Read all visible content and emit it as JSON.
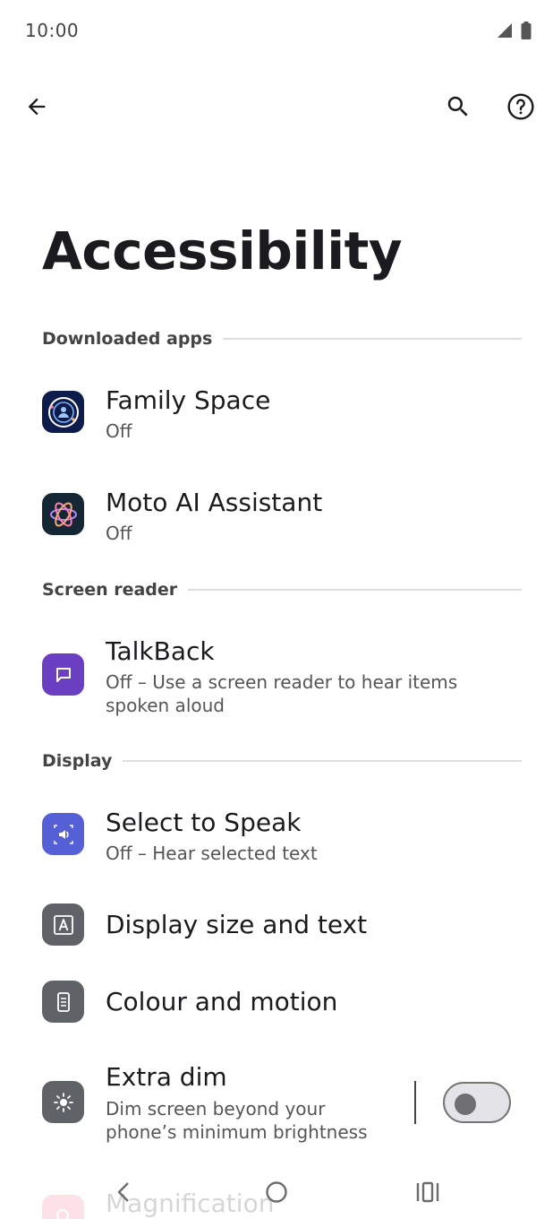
{
  "status_bar": {
    "time": "10:00"
  },
  "app_bar": {
    "back_icon": "arrow-back-icon",
    "search_icon": "search-icon",
    "help_icon": "help-circle-icon"
  },
  "page": {
    "title": "Accessibility"
  },
  "sections": {
    "downloaded_apps": "Downloaded apps",
    "screen_reader": "Screen reader",
    "display": "Display"
  },
  "items": {
    "family_space": {
      "title": "Family Space",
      "summary": "Off"
    },
    "moto_ai": {
      "title": "Moto AI Assistant",
      "summary": "Off"
    },
    "talkback": {
      "title": "TalkBack",
      "summary": "Off – Use a screen reader to hear items spoken aloud"
    },
    "select_to_speak": {
      "title": "Select to Speak",
      "summary": "Off – Hear selected text"
    },
    "display_size": {
      "title": "Display size and text"
    },
    "colour_motion": {
      "title": "Colour and motion"
    },
    "extra_dim": {
      "title": "Extra dim",
      "summary": "Dim screen beyond your phone’s minimum brightness",
      "toggle_on": false
    },
    "magnification": {
      "title": "Magnification"
    }
  },
  "colors": {
    "talkback_bg": "#6a3fc1",
    "select_to_speak_bg": "#5560d6",
    "family_space_bg": "#0d1c4a",
    "moto_ai_bg": "#152734",
    "grey_icon_bg": "#5f6368",
    "magnification_bg": "#f25c7a"
  }
}
